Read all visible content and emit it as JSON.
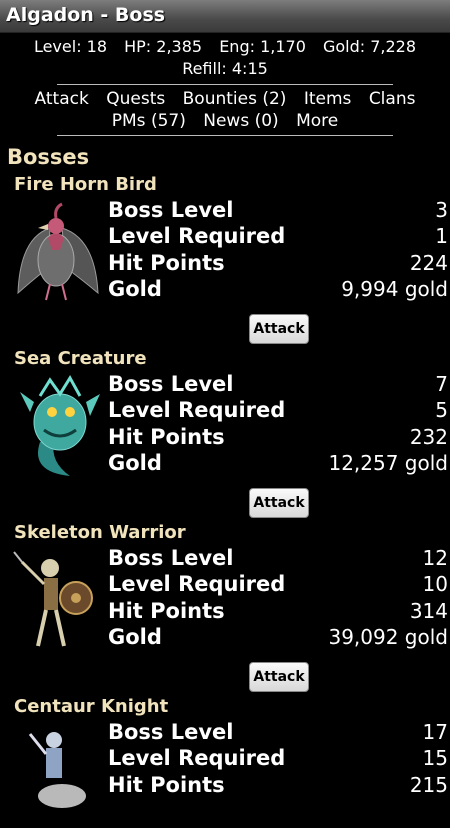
{
  "title": "Algadon - Boss",
  "stats": {
    "level": "Level: 18",
    "hp": "HP: 2,385",
    "eng": "Eng: 1,170",
    "gold": "Gold: 7,228",
    "refill": "Refill: 4:15"
  },
  "nav": [
    "Attack",
    "Quests",
    "Bounties (2)",
    "Items",
    "Clans",
    "PMs (57)",
    "News (0)",
    "More"
  ],
  "section_title": "Bosses",
  "labels": {
    "boss_level": "Boss Level",
    "level_required": "Level Required",
    "hit_points": "Hit Points",
    "gold": "Gold",
    "attack": "Attack"
  },
  "bosses": [
    {
      "name": "Fire Horn Bird",
      "boss_level": "3",
      "level_required": "1",
      "hit_points": "224",
      "gold": "9,994 gold",
      "icon": "bird-monster-icon"
    },
    {
      "name": "Sea Creature",
      "boss_level": "7",
      "level_required": "5",
      "hit_points": "232",
      "gold": "12,257 gold",
      "icon": "sea-creature-icon"
    },
    {
      "name": "Skeleton Warrior",
      "boss_level": "12",
      "level_required": "10",
      "hit_points": "314",
      "gold": "39,092 gold",
      "icon": "skeleton-warrior-icon"
    },
    {
      "name": "Centaur Knight",
      "boss_level": "17",
      "level_required": "15",
      "hit_points": "215",
      "icon": "centaur-knight-icon"
    }
  ]
}
